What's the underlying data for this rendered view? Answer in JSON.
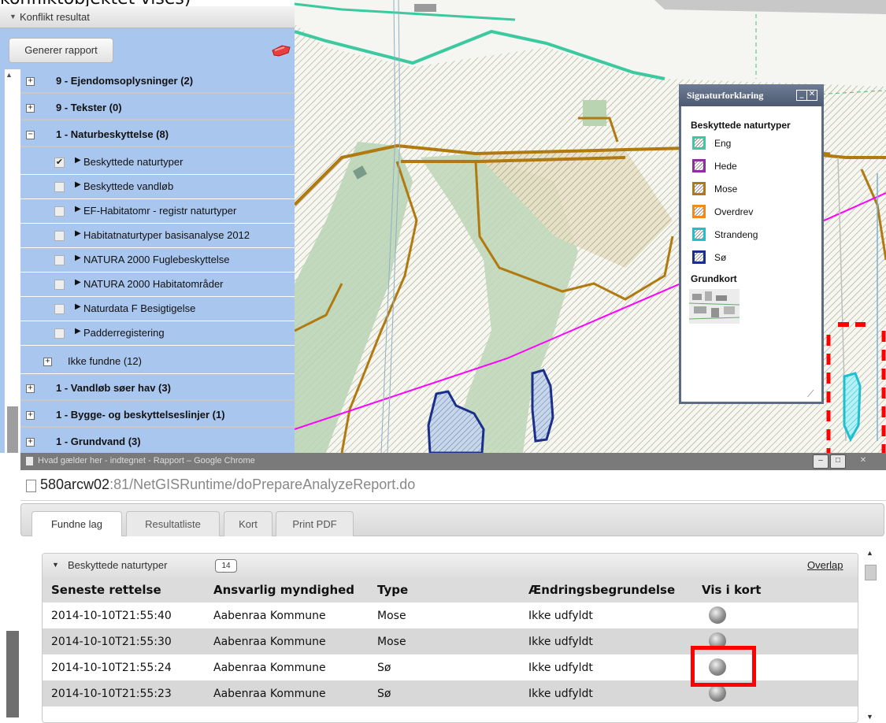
{
  "caption": "konfliktobjektet vises)",
  "panel": {
    "header": "Konflikt resultat",
    "report_button": "Generer rapport",
    "groups_top": [
      {
        "label": "9 - Ejendomsoplysninger (2)",
        "expander": "+"
      },
      {
        "label": "9 - Tekster (0)",
        "expander": "+"
      },
      {
        "label": "1 - Naturbeskyttelse (8)",
        "expander": "−"
      }
    ],
    "sublayers": [
      {
        "label": "Beskyttede naturtyper",
        "checked": "✔"
      },
      {
        "label": "Beskyttede vandløb",
        "checked": ""
      },
      {
        "label": "EF-Habitatomr - registr naturtyper",
        "checked": ""
      },
      {
        "label": "Habitatnaturtyper basisanalyse 2012",
        "checked": ""
      },
      {
        "label": "NATURA 2000 Fuglebeskyttelse",
        "checked": ""
      },
      {
        "label": "NATURA 2000 Habitatområder",
        "checked": ""
      },
      {
        "label": "Naturdata F Besigtigelse",
        "checked": ""
      },
      {
        "label": "Padderregistering",
        "checked": ""
      }
    ],
    "not_found": "Ikke fundne (12)",
    "groups_bottom": [
      {
        "label": "1 - Vandløb søer hav (3)",
        "expander": "+"
      },
      {
        "label": "1 - Bygge- og beskyttelseslinjer (1)",
        "expander": "+"
      },
      {
        "label": "1 - Grundvand (3)",
        "expander": "+"
      }
    ]
  },
  "legend": {
    "title": "Signaturforklaring",
    "section1": "Beskyttede naturtyper",
    "items": [
      {
        "name": "Eng",
        "color": "#3dc9a0"
      },
      {
        "name": "Hede",
        "color": "#8e2f9e"
      },
      {
        "name": "Mose",
        "color": "#b07a10"
      },
      {
        "name": "Overdrev",
        "color": "#f08a1a"
      },
      {
        "name": "Strandeng",
        "color": "#1fbfd0"
      },
      {
        "name": "Sø",
        "color": "#1a2f8a"
      }
    ],
    "section2": "Grundkort"
  },
  "browser": {
    "title": "Hvad gælder her - indtegnet - Rapport – Google Chrome",
    "url_host": "580arcw02",
    "url_rest": ":81/NetGISRuntime/doPrepareAnalyzeReport.do",
    "tabs": [
      "Fundne lag",
      "Resultatliste",
      "Kort",
      "Print PDF"
    ]
  },
  "result": {
    "title": "Beskyttede naturtyper",
    "count": "14",
    "overlap_link": "Overlap",
    "columns": [
      "Seneste rettelse",
      "Ansvarlig myndighed",
      "Type",
      "Ændringsbegrundelse",
      "Vis i kort"
    ],
    "rows": [
      {
        "date": "2014-10-10T21:55:40",
        "authority": "Aabenraa Kommune",
        "type": "Mose",
        "reason": "Ikke udfyldt"
      },
      {
        "date": "2014-10-10T21:55:30",
        "authority": "Aabenraa Kommune",
        "type": "Mose",
        "reason": "Ikke udfyldt"
      },
      {
        "date": "2014-10-10T21:55:24",
        "authority": "Aabenraa Kommune",
        "type": "Sø",
        "reason": "Ikke udfyldt"
      },
      {
        "date": "2014-10-10T21:55:23",
        "authority": "Aabenraa Kommune",
        "type": "Sø",
        "reason": "Ikke udfyldt"
      }
    ]
  },
  "colors": {
    "highlight": "#ff0000",
    "panel_blue": "#a9c6ee",
    "road": "#ff00ff"
  }
}
